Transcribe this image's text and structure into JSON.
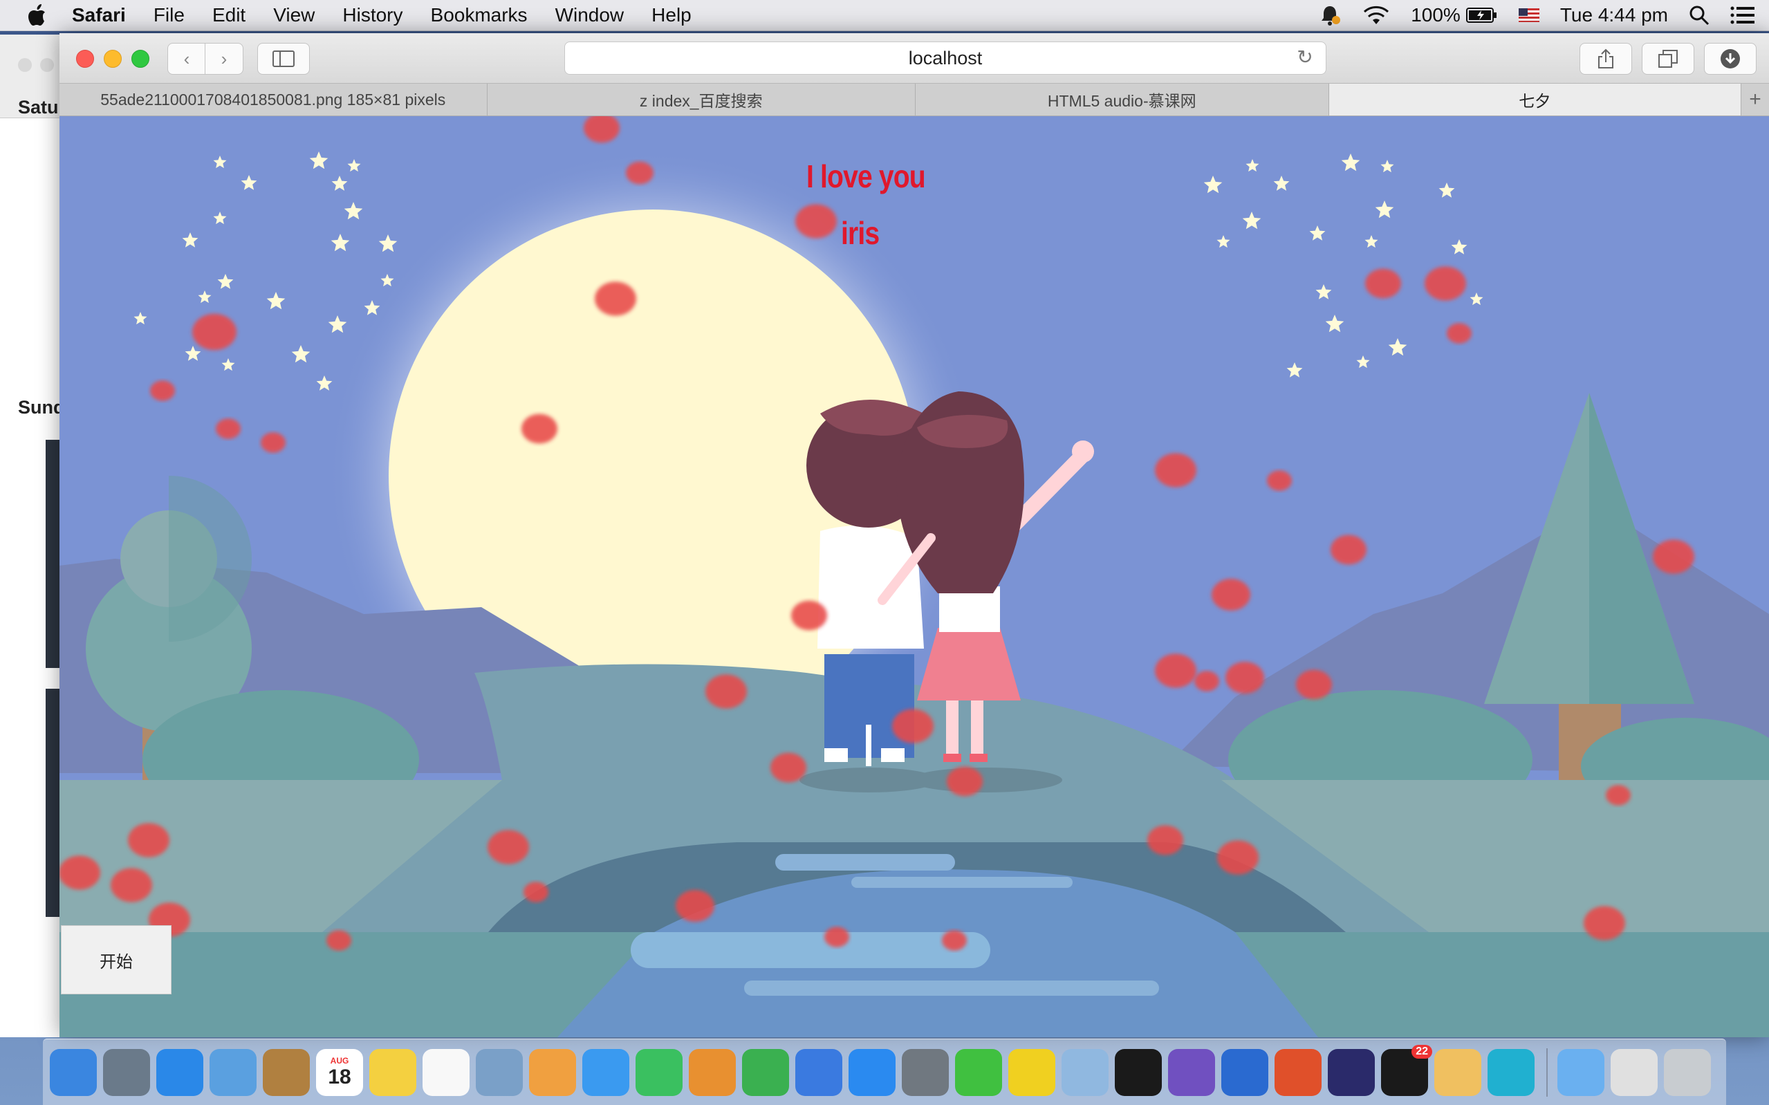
{
  "menubar": {
    "app": "Safari",
    "items": [
      "File",
      "Edit",
      "View",
      "History",
      "Bookmarks",
      "Window",
      "Help"
    ],
    "battery": "100%",
    "clock": "Tue 4:44 pm",
    "icons": [
      "notification-icon",
      "wifi-icon",
      "battery-icon",
      "flag-us-icon",
      "spotlight-icon",
      "list-icon"
    ]
  },
  "background_window": {
    "label_top": "Satu",
    "label_mid": "Sund"
  },
  "toolbar": {
    "url": "localhost"
  },
  "tabs": [
    {
      "label": "55ade2110001708401850081.png 185×81 pixels",
      "active": false
    },
    {
      "label": "z index_百度搜索",
      "active": false
    },
    {
      "label": "HTML5 audio-慕课网",
      "active": false
    },
    {
      "label": "七夕",
      "active": true
    }
  ],
  "page": {
    "headline_1": "I love you",
    "headline_2": "iris",
    "start_button": "开始",
    "colors": {
      "sky": "#7b93d4",
      "moon": "#fff8d0",
      "text": "#e0182c",
      "petal": "#e84a4a"
    }
  },
  "dock": {
    "icons": [
      {
        "name": "finder",
        "color": "#3a86e0"
      },
      {
        "name": "launchpad",
        "color": "#6a7a8a"
      },
      {
        "name": "safari",
        "color": "#2a88e8"
      },
      {
        "name": "mail",
        "color": "#5aa0e0"
      },
      {
        "name": "contacts",
        "color": "#b08040"
      },
      {
        "name": "calendar",
        "color": "#ffffff",
        "month": "AUG",
        "day": "18"
      },
      {
        "name": "notes",
        "color": "#f4d040"
      },
      {
        "name": "reminders",
        "color": "#f8f8f8"
      },
      {
        "name": "preview",
        "color": "#7aa0c8"
      },
      {
        "name": "photos",
        "color": "#f0a040"
      },
      {
        "name": "messages",
        "color": "#3a9af0"
      },
      {
        "name": "facetime",
        "color": "#3ac060"
      },
      {
        "name": "pages",
        "color": "#e89030"
      },
      {
        "name": "numbers",
        "color": "#3ab050"
      },
      {
        "name": "keynote",
        "color": "#3a7ae0"
      },
      {
        "name": "app-store",
        "color": "#2a8af0"
      },
      {
        "name": "system-preferences",
        "color": "#707880"
      },
      {
        "name": "wechat",
        "color": "#40c040"
      },
      {
        "name": "qq-music",
        "color": "#f0d020"
      },
      {
        "name": "preview-2",
        "color": "#90b8e0"
      },
      {
        "name": "terminal",
        "color": "#1a1a1a"
      },
      {
        "name": "dash",
        "color": "#7050c0"
      },
      {
        "name": "word",
        "color": "#2a6ad0"
      },
      {
        "name": "powerpoint",
        "color": "#e0502a"
      },
      {
        "name": "eclipse",
        "color": "#2a2a6a"
      },
      {
        "name": "qq",
        "color": "#1a1a1a",
        "badge": "22"
      },
      {
        "name": "scissors-app",
        "color": "#f0c060"
      },
      {
        "name": "webstorm",
        "color": "#20b0d0"
      },
      {
        "name": "folder",
        "color": "#6ab0f0"
      },
      {
        "name": "folder-2",
        "color": "#e0e0e0"
      },
      {
        "name": "trash",
        "color": "#c8ccd0"
      }
    ]
  }
}
